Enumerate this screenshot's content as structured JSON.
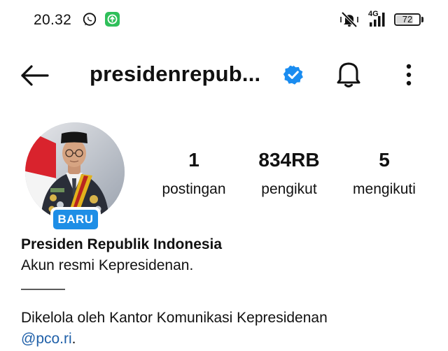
{
  "status_bar": {
    "time": "20.32",
    "icons": [
      "whatsapp-icon",
      "green-app-icon",
      "mute-vibrate-icon",
      "signal-4g-icon",
      "battery-icon"
    ],
    "network": "4G",
    "battery": "72",
    "battery_level": 0.72
  },
  "header": {
    "username": "presidenrepub...",
    "verified": true,
    "icons": [
      "back-arrow-icon",
      "verified-badge-icon",
      "bell-icon",
      "more-vertical-icon"
    ]
  },
  "profile": {
    "badge": "BARU",
    "stats": [
      {
        "value": "1",
        "label": "postingan"
      },
      {
        "value": "834RB",
        "label": "pengikut"
      },
      {
        "value": "5",
        "label": "mengikuti"
      }
    ]
  },
  "bio": {
    "name": "Presiden Republik Indonesia",
    "line1": "Akun resmi Kepresidenan.",
    "separator": "———",
    "line2": "Dikelola oleh Kantor Komunikasi Kepresidenan",
    "link": "@pco.ri",
    "link_suffix": "."
  },
  "colors": {
    "accent": "#1e8ee6",
    "link": "#1e5fa8",
    "verified": "#1a8cf0",
    "text": "#111111"
  }
}
